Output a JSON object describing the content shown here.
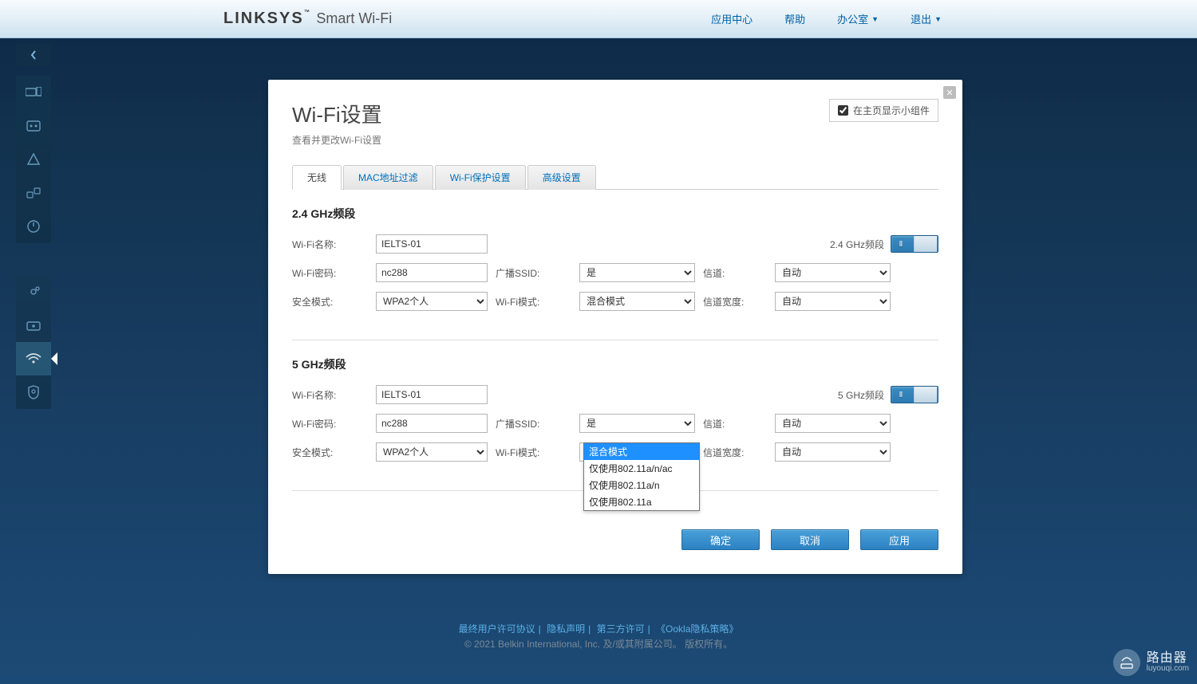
{
  "brand": {
    "name": "LINKSYS",
    "tm": "™",
    "tagline": "Smart Wi-Fi"
  },
  "topnav": {
    "apps": "应用中心",
    "help": "帮助",
    "account": "办公室",
    "logout": "退出"
  },
  "panel": {
    "title": "Wi-Fi设置",
    "subtitle": "查看并更改Wi-Fi设置",
    "show_widget_label": "在主页显示小组件"
  },
  "tabs": {
    "wireless": "无线",
    "mac_filter": "MAC地址过滤",
    "wps": "Wi-Fi保护设置",
    "advanced": "高级设置"
  },
  "labels": {
    "section_24": "2.4 GHz频段",
    "section_5": "5 GHz频段",
    "wifi_name": "Wi-Fi名称:",
    "wifi_password": "Wi-Fi密码:",
    "security_mode": "安全模式:",
    "broadcast_ssid": "广播SSID:",
    "wifi_mode": "Wi-Fi模式:",
    "channel": "信道:",
    "channel_width": "信道宽度:",
    "band_24": "2.4 GHz频段",
    "band_5": "5 GHz频段"
  },
  "band24": {
    "name": "IELTS-01",
    "password": "nc288",
    "security": "WPA2个人",
    "broadcast": "是",
    "mode": "混合模式",
    "channel": "自动",
    "width": "自动"
  },
  "band5": {
    "name": "IELTS-01",
    "password": "nc288",
    "security": "WPA2个人",
    "broadcast": "是",
    "mode": "混合模式",
    "channel": "自动",
    "width": "自动"
  },
  "mode5_options": {
    "mixed": "混合模式",
    "a_n_ac": "仅使用802.11a/n/ac",
    "a_n": "仅使用802.11a/n",
    "a": "仅使用802.11a"
  },
  "buttons": {
    "ok": "确定",
    "cancel": "取消",
    "apply": "应用"
  },
  "footer": {
    "eula": "最终用户许可协议",
    "privacy": "隐私声明",
    "thirdparty": "第三方许可",
    "ookla": "《Ookla隐私策略》",
    "copyright": "© 2021 Belkin International, Inc. 及/或其附属公司。 版权所有。"
  },
  "watermark": {
    "main": "路由器",
    "sub": "luyouqi.com"
  },
  "toggle_on": "| |"
}
